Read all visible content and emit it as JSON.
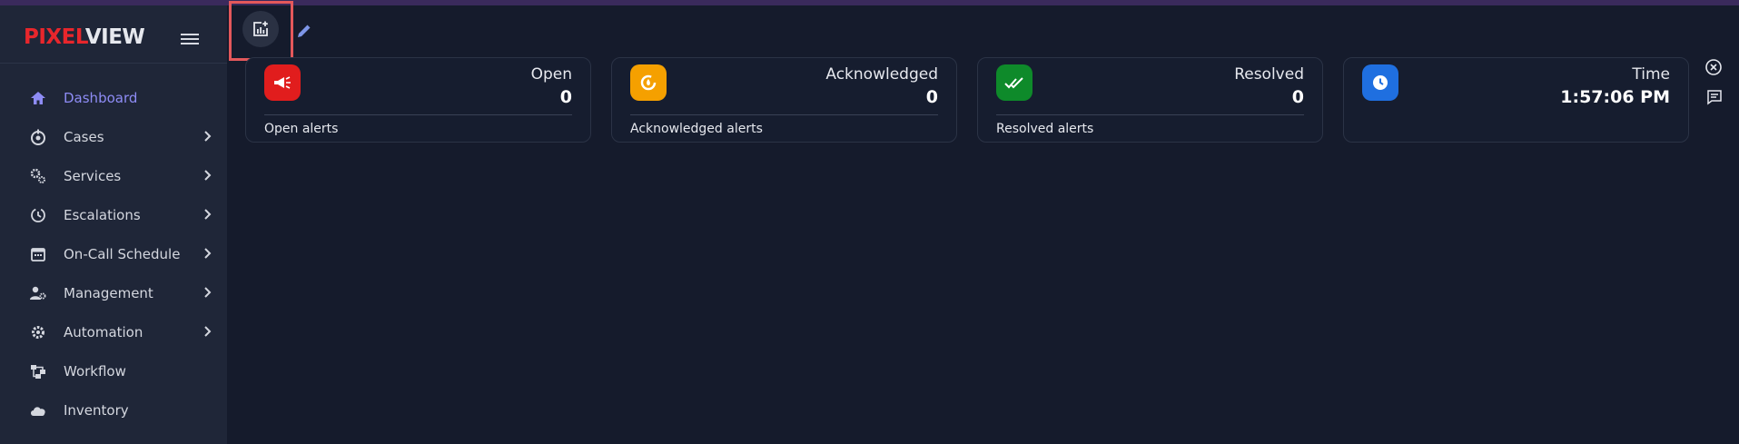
{
  "brand": {
    "part1": "PIXEL",
    "part2": "VIEW"
  },
  "sidebar": {
    "items": [
      {
        "label": "Dashboard",
        "icon": "home-icon",
        "active": true,
        "has_submenu": false
      },
      {
        "label": "Cases",
        "icon": "cases-icon",
        "active": false,
        "has_submenu": true
      },
      {
        "label": "Services",
        "icon": "services-gears-icon",
        "active": false,
        "has_submenu": true
      },
      {
        "label": "Escalations",
        "icon": "escalations-icon",
        "active": false,
        "has_submenu": true
      },
      {
        "label": "On-Call Schedule",
        "icon": "calendar-icon",
        "active": false,
        "has_submenu": true
      },
      {
        "label": "Management",
        "icon": "user-gear-icon",
        "active": false,
        "has_submenu": true
      },
      {
        "label": "Automation",
        "icon": "automation-gear-icon",
        "active": false,
        "has_submenu": true
      },
      {
        "label": "Workflow",
        "icon": "workflow-icon",
        "active": false,
        "has_submenu": false
      },
      {
        "label": "Inventory",
        "icon": "cloud-icon",
        "active": false,
        "has_submenu": false
      }
    ]
  },
  "cards": [
    {
      "title": "Open",
      "value": "0",
      "footer": "Open alerts",
      "color": "#e11d1d",
      "icon": "megaphone-icon"
    },
    {
      "title": "Acknowledged",
      "value": "0",
      "footer": "Acknowledged alerts",
      "color": "#f5a000",
      "icon": "acknowledge-icon"
    },
    {
      "title": "Resolved",
      "value": "0",
      "footer": "Resolved alerts",
      "color": "#0e8a2a",
      "icon": "double-check-icon"
    },
    {
      "title": "Time",
      "value": "1:57:06 PM",
      "footer": "",
      "color": "#1f6fe0",
      "icon": "clock-icon"
    }
  ],
  "colors": {
    "accent": "#8e8cf5",
    "highlight": "#e4585b",
    "background": "#151b2c",
    "sidebar": "#1f2638"
  }
}
